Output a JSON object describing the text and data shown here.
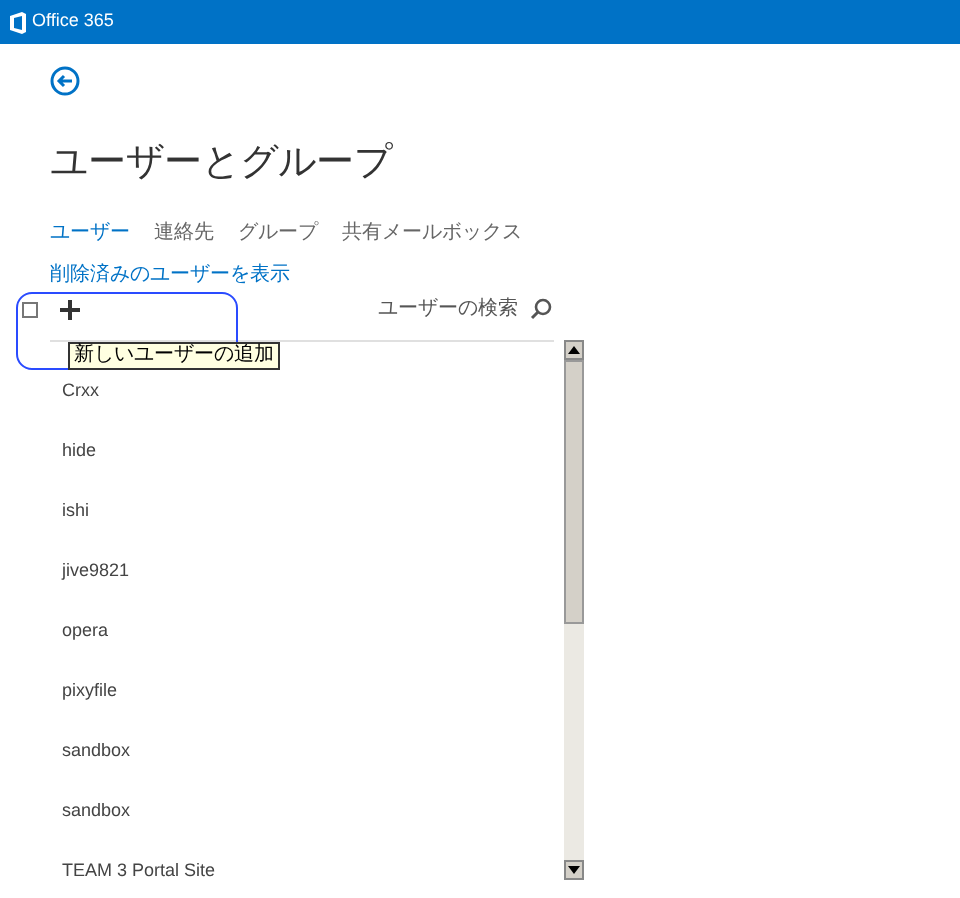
{
  "header": {
    "brand": "Office 365"
  },
  "title": "ユーザーとグループ",
  "tabs": [
    {
      "label": "ユーザー",
      "selected": true
    },
    {
      "label": "連絡先",
      "selected": false
    },
    {
      "label": "グループ",
      "selected": false
    },
    {
      "label": "共有メールボックス",
      "selected": false
    }
  ],
  "deleted_users_link": "削除済みのユーザーを表示",
  "toolbar": {
    "select_all_checked": false,
    "add_tooltip": "新しいユーザーの追加",
    "search_label": "ユーザーの検索"
  },
  "users": [
    "Crxx",
    "hide",
    "ishi",
    "jive9821",
    "opera",
    "pixyfile",
    "sandbox",
    "sandbox",
    "TEAM 3 Portal Site"
  ]
}
